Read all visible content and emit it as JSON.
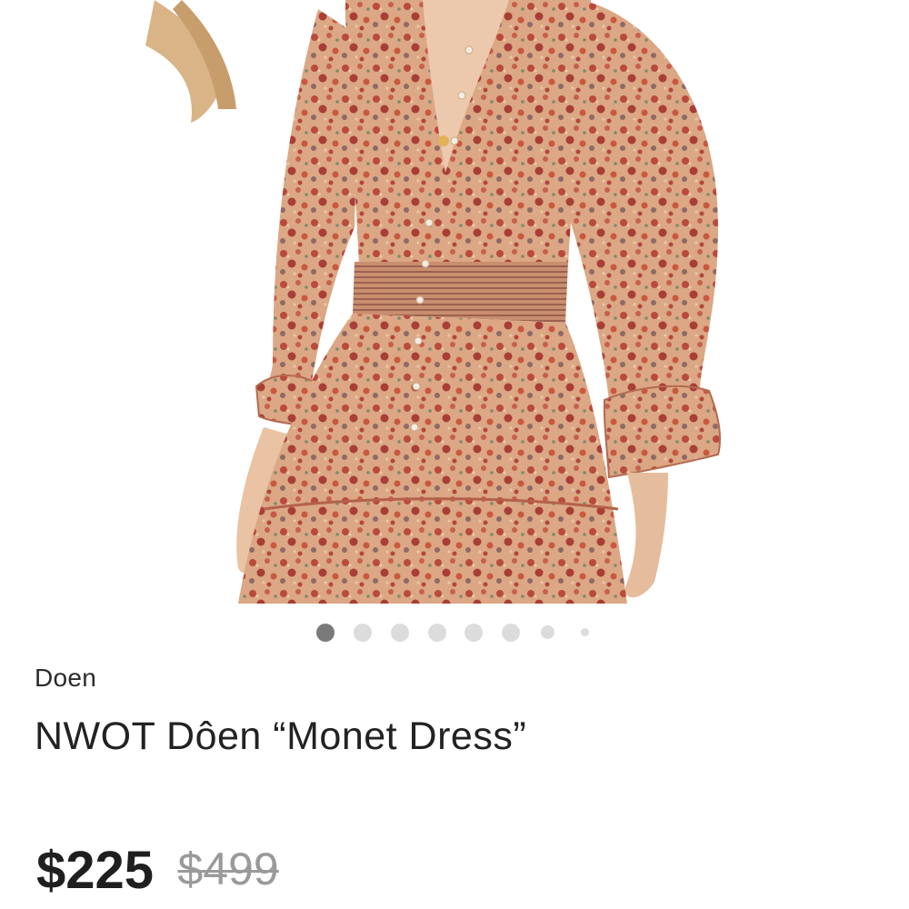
{
  "listing": {
    "brand": "Doen",
    "title": "NWOT Dôen “Monet Dress”",
    "price": "$225",
    "original_price": "$499"
  },
  "gallery": {
    "image_subject": "floral print smocked-waist dress with ruffled cuffs",
    "active_index": 0,
    "dot_count": 8,
    "colors": {
      "dress_base": "#d9a27c",
      "print_red": "#b5453a",
      "active_dot": "#7a7a7a",
      "inactive_dot": "#dcdcdc"
    }
  }
}
